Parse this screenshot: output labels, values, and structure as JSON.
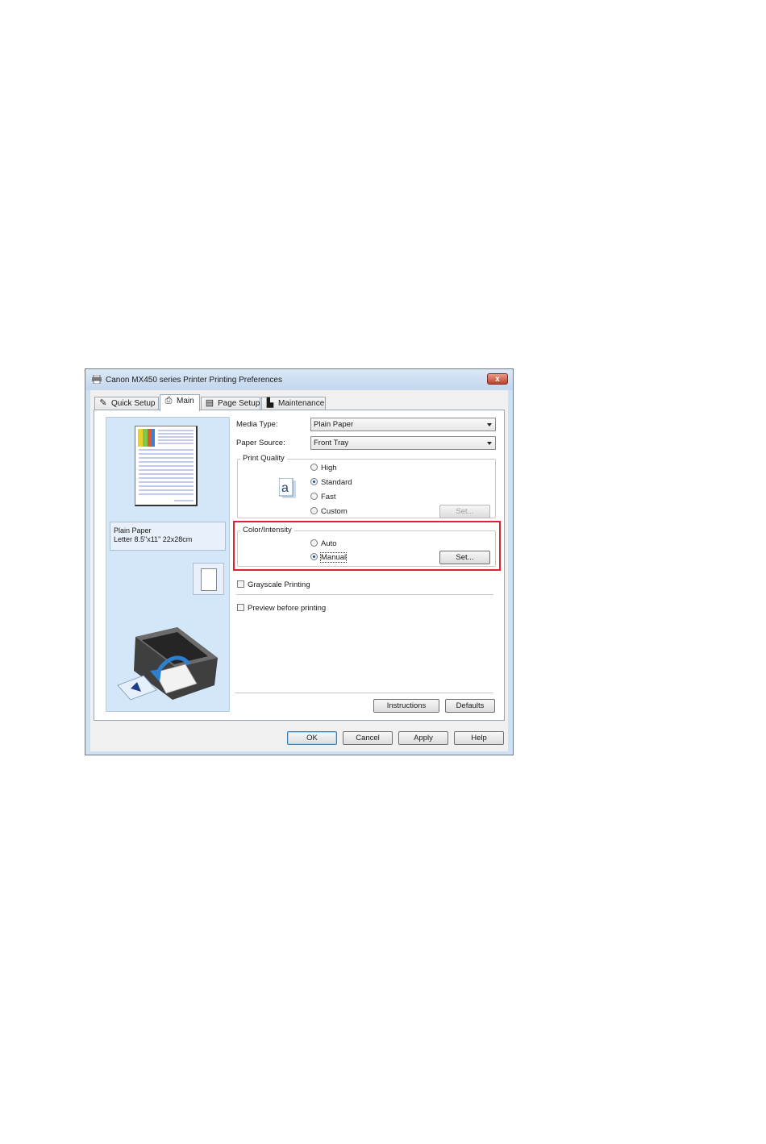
{
  "window": {
    "title": "Canon MX450 series Printer Printing Preferences",
    "close_label": "x"
  },
  "tabs": [
    {
      "label": "Quick Setup",
      "icon": "quick-setup-icon"
    },
    {
      "label": "Main",
      "icon": "main-icon",
      "active": true
    },
    {
      "label": "Page Setup",
      "icon": "page-setup-icon"
    },
    {
      "label": "Maintenance",
      "icon": "maintenance-icon"
    }
  ],
  "preview": {
    "paper_type": "Plain Paper",
    "paper_size": "Letter 8.5\"x11\" 22x28cm"
  },
  "main": {
    "media_type_label": "Media Type:",
    "media_type_value": "Plain Paper",
    "paper_source_label": "Paper Source:",
    "paper_source_value": "Front Tray",
    "print_quality": {
      "title": "Print Quality",
      "options": [
        "High",
        "Standard",
        "Fast",
        "Custom"
      ],
      "selected": "Standard",
      "set_label": "Set..."
    },
    "color_intensity": {
      "title": "Color/Intensity",
      "options": [
        "Auto",
        "Manual"
      ],
      "selected": "Manual",
      "set_label": "Set..."
    },
    "grayscale_label": "Grayscale Printing",
    "preview_label": "Preview before printing",
    "instructions_label": "Instructions",
    "defaults_label": "Defaults"
  },
  "footer": {
    "ok_label": "OK",
    "cancel_label": "Cancel",
    "apply_label": "Apply",
    "help_label": "Help"
  },
  "colors": {
    "highlight_border": "#d9272e",
    "preview_background": "#d4e7f8",
    "titlebar": "#c2d6ee"
  }
}
